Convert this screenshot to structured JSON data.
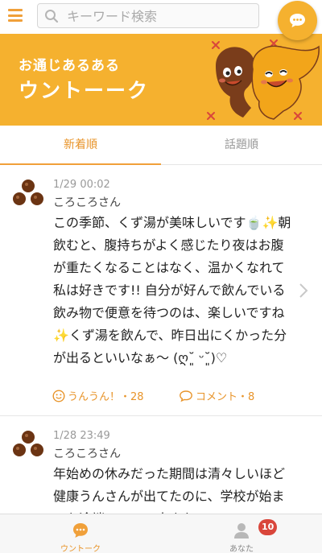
{
  "header": {
    "search_placeholder": "キーワード検索"
  },
  "banner": {
    "subtitle": "お通じあるある",
    "title": "ウントーーク"
  },
  "tabs": [
    {
      "label": "新着順",
      "active": true
    },
    {
      "label": "話題順",
      "active": false
    }
  ],
  "posts": [
    {
      "timestamp": "1/29 00:02",
      "username": "ころころさん",
      "body": "この季節、くず湯が美味しいです🍵✨朝飲むと、腹持ちがよく感じたり夜はお腹が重たくなることはなく、温かくなれて 私は好きです!! 自分が好んで飲んでいる飲み物で便意を待つのは、楽しいですね✨くず湯を飲んで、昨日出にくかった分が出るといいなぁ〜 (ღ˘͈ ᵕ˘͈)♡",
      "likes_label": "うんうん！・28",
      "comments_label": "コメント・8"
    },
    {
      "timestamp": "1/28 23:49",
      "username": "ころころさん",
      "body": "年始めの休みだった期間は清々しいほど健康うんさんが出てたのに、学校が始まった途端コロコロ大きな..."
    }
  ],
  "bottom_nav": {
    "items": [
      {
        "label": "ウントーク",
        "active": true
      },
      {
        "label": "あなた",
        "active": false,
        "badge": "10"
      }
    ]
  },
  "colors": {
    "accent": "#f5b12f",
    "accent_text": "#e8942a",
    "badge": "#d9463b"
  },
  "icons": [
    "menu-icon",
    "search-icon",
    "chat-icon",
    "mascot-illustration",
    "poop-avatar-icon",
    "chevron-right-icon",
    "smile-icon",
    "speech-bubble-icon",
    "user-icon"
  ]
}
